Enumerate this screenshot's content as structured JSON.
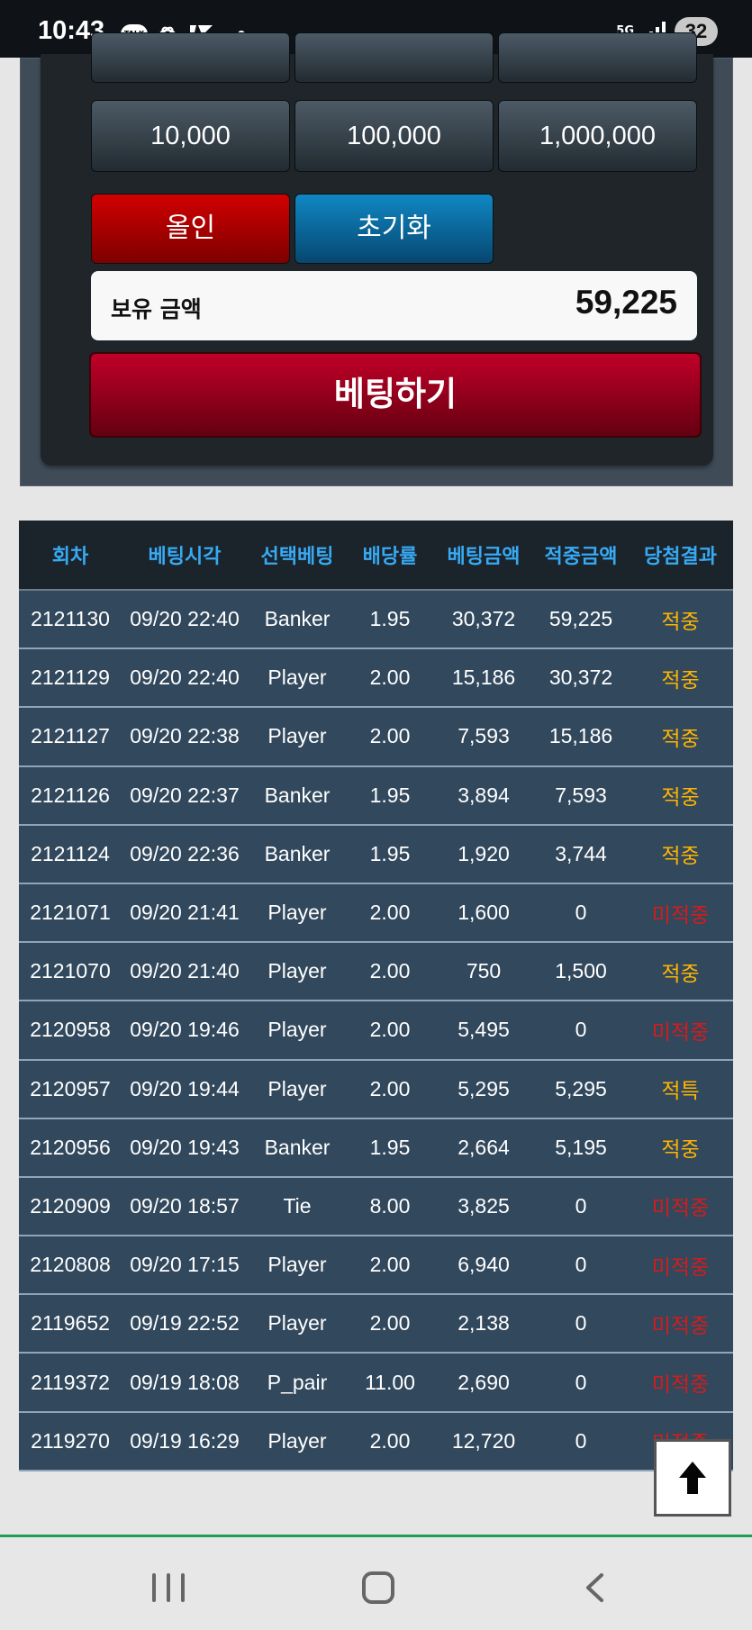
{
  "status": {
    "time": "10:43",
    "talk_badge": "TALK",
    "network": "5G",
    "battery": "32",
    "icons": [
      "kakao-talk-icon",
      "openai-icon",
      "vpn-icon",
      "notification-dot-icon",
      "network-5g-icon",
      "signal-icon",
      "battery-icon"
    ]
  },
  "bet_panel": {
    "amount_buttons": [
      "10,000",
      "100,000",
      "1,000,000"
    ],
    "all_in_label": "올인",
    "reset_label": "초기화",
    "balance_label": "보유 금액",
    "balance_value": "59,225",
    "bet_button_label": "베팅하기"
  },
  "table": {
    "headers": [
      "회차",
      "베팅시각",
      "선택베팅",
      "배당률",
      "베팅금액",
      "적중금액",
      "당첨결과"
    ],
    "rows": [
      {
        "round": "2121130",
        "time": "09/20 22:40",
        "choice": "Banker",
        "odds": "1.95",
        "bet": "30,372",
        "win": "59,225",
        "result": "적중"
      },
      {
        "round": "2121129",
        "time": "09/20 22:40",
        "choice": "Player",
        "odds": "2.00",
        "bet": "15,186",
        "win": "30,372",
        "result": "적중"
      },
      {
        "round": "2121127",
        "time": "09/20 22:38",
        "choice": "Player",
        "odds": "2.00",
        "bet": "7,593",
        "win": "15,186",
        "result": "적중"
      },
      {
        "round": "2121126",
        "time": "09/20 22:37",
        "choice": "Banker",
        "odds": "1.95",
        "bet": "3,894",
        "win": "7,593",
        "result": "적중"
      },
      {
        "round": "2121124",
        "time": "09/20 22:36",
        "choice": "Banker",
        "odds": "1.95",
        "bet": "1,920",
        "win": "3,744",
        "result": "적중"
      },
      {
        "round": "2121071",
        "time": "09/20 21:41",
        "choice": "Player",
        "odds": "2.00",
        "bet": "1,600",
        "win": "0",
        "result": "미적중"
      },
      {
        "round": "2121070",
        "time": "09/20 21:40",
        "choice": "Player",
        "odds": "2.00",
        "bet": "750",
        "win": "1,500",
        "result": "적중"
      },
      {
        "round": "2120958",
        "time": "09/20 19:46",
        "choice": "Player",
        "odds": "2.00",
        "bet": "5,495",
        "win": "0",
        "result": "미적중"
      },
      {
        "round": "2120957",
        "time": "09/20 19:44",
        "choice": "Player",
        "odds": "2.00",
        "bet": "5,295",
        "win": "5,295",
        "result": "적특"
      },
      {
        "round": "2120956",
        "time": "09/20 19:43",
        "choice": "Banker",
        "odds": "1.95",
        "bet": "2,664",
        "win": "5,195",
        "result": "적중"
      },
      {
        "round": "2120909",
        "time": "09/20 18:57",
        "choice": "Tie",
        "odds": "8.00",
        "bet": "3,825",
        "win": "0",
        "result": "미적중"
      },
      {
        "round": "2120808",
        "time": "09/20 17:15",
        "choice": "Player",
        "odds": "2.00",
        "bet": "6,940",
        "win": "0",
        "result": "미적중"
      },
      {
        "round": "2119652",
        "time": "09/19 22:52",
        "choice": "Player",
        "odds": "2.00",
        "bet": "2,138",
        "win": "0",
        "result": "미적중"
      },
      {
        "round": "2119372",
        "time": "09/19 18:08",
        "choice": "P_pair",
        "odds": "11.00",
        "bet": "2,690",
        "win": "0",
        "result": "미적중"
      },
      {
        "round": "2119270",
        "time": "09/19 16:29",
        "choice": "Player",
        "odds": "2.00",
        "bet": "12,720",
        "win": "0",
        "result": "미적중"
      }
    ]
  },
  "colors": {
    "win": "#ffb400",
    "loss": "#d61b1b",
    "header_text": "#37aaf3",
    "all_in": "#c10000",
    "reset": "#0b67a3",
    "bet": "#a00021"
  },
  "navigation": {
    "icons": [
      "recent-apps-icon",
      "home-icon",
      "back-icon"
    ]
  }
}
